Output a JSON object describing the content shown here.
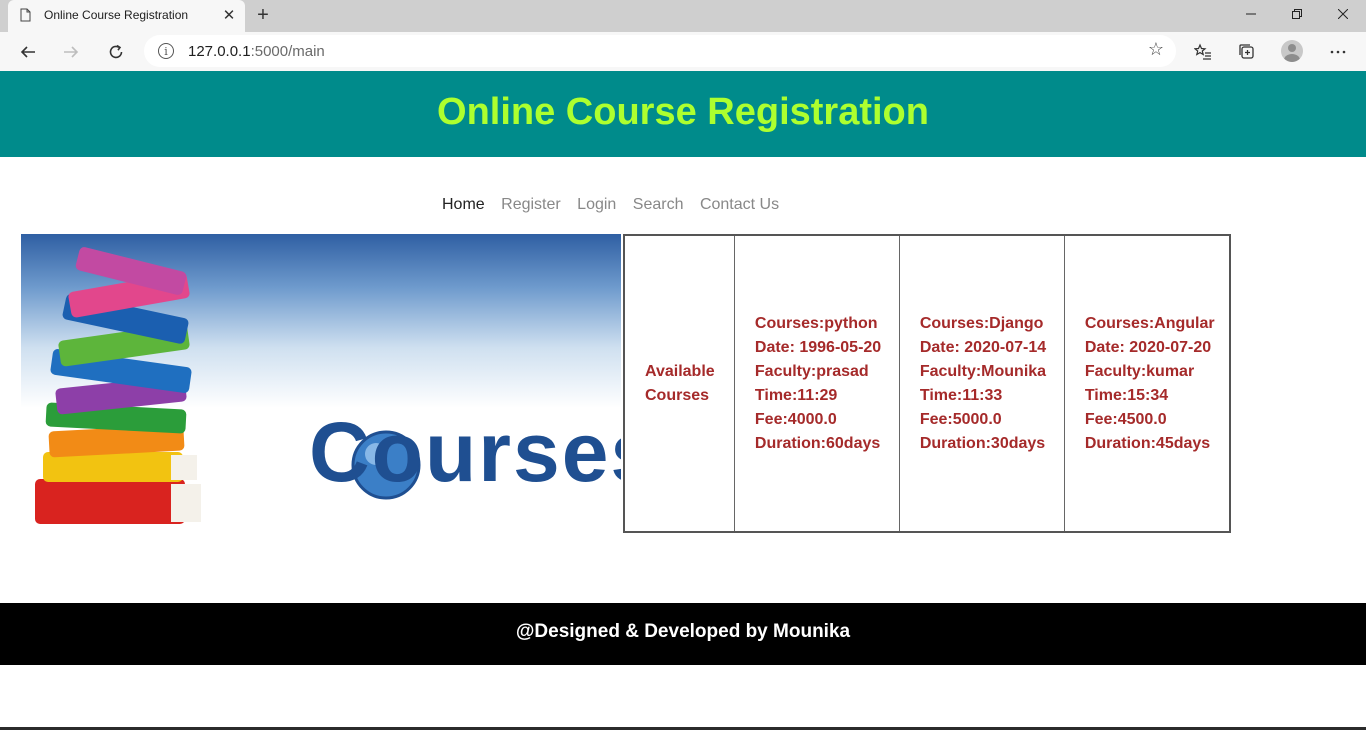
{
  "browser": {
    "tab_title": "Online Course Registration",
    "tab_close": "✕",
    "new_tab": "+",
    "url_host": "127.0.0.1",
    "url_rest": ":5000/main",
    "icons": [
      "document-icon",
      "back-arrow-icon",
      "forward-arrow-icon",
      "refresh-icon",
      "info-icon",
      "star-icon",
      "favorites-icon",
      "collections-icon",
      "profile-avatar-icon",
      "more-icon"
    ]
  },
  "header": {
    "title": "Online Course Registration",
    "bg_color": "#008b8b",
    "title_color": "#adff2f"
  },
  "nav": {
    "items": [
      "Home",
      "Register",
      "Login",
      "Search",
      "Contact Us"
    ]
  },
  "banner": {
    "text": "Courses"
  },
  "courses_table": {
    "heading": "Available Courses",
    "text_color": "#a52a2a",
    "courses": [
      {
        "name": "Courses:python",
        "date": "Date: 1996-05-20",
        "faculty": "Faculty:prasad",
        "time": "Time:11:29",
        "fee": "Fee:4000.0",
        "duration": "Duration:60days"
      },
      {
        "name": "Courses:Django",
        "date": "Date: 2020-07-14",
        "faculty": "Faculty:Mounika",
        "time": "Time:11:33",
        "fee": "Fee:5000.0",
        "duration": "Duration:30days"
      },
      {
        "name": "Courses:Angular",
        "date": "Date: 2020-07-20",
        "faculty": "Faculty:kumar",
        "time": "Time:15:34",
        "fee": "Fee:4500.0",
        "duration": "Duration:45days"
      }
    ]
  },
  "footer": {
    "text": "@Designed & Developed by Mounika"
  }
}
